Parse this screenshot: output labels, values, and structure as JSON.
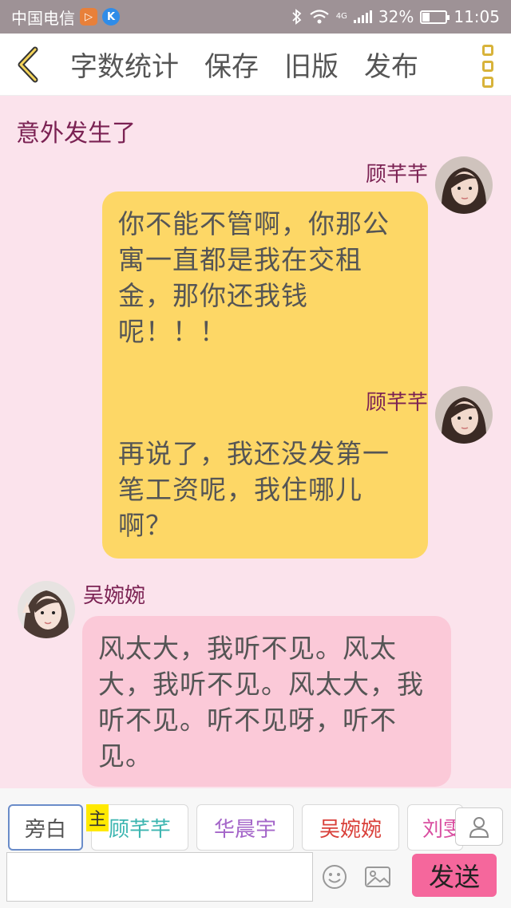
{
  "status_bar": {
    "carrier": "中国电信",
    "battery": "32%",
    "battery_level": 0.32,
    "time": "11:05",
    "network": "4G"
  },
  "toolbar": {
    "word_count": "字数统计",
    "save": "保存",
    "old_version": "旧版",
    "publish": "发布"
  },
  "chapter_title": "意外发生了",
  "messages": [
    {
      "speaker": "顾芊芊",
      "side": "right",
      "text": "你不能不管啊，你那公寓一直都是我在交租金，那你还我钱呢！！！"
    },
    {
      "speaker": "顾芊芊",
      "side": "right",
      "text": "再说了，我还没发第一笔工资呢，我住哪儿啊？"
    },
    {
      "speaker": "吴婉婉",
      "side": "left",
      "text": "风太大，我听不见。风太大，我听不见。风太大，我听不见。听不见呀，听不见。"
    }
  ],
  "roles": [
    {
      "label": "旁白",
      "color": "#555555"
    },
    {
      "label": "顾芊芊",
      "color": "#3bb5b0"
    },
    {
      "label": "华晨宇",
      "color": "#a466c9"
    },
    {
      "label": "吴婉婉",
      "color": "#d9403a"
    },
    {
      "label": "刘雯",
      "color": "#d94ea0"
    }
  ],
  "main_tag": "主",
  "input": {
    "value": "",
    "placeholder": ""
  },
  "send_label": "发送",
  "colors": {
    "accent_yellow": "#fdd766",
    "bubble_pink": "#fbc9d8",
    "send_pink": "#f5679c",
    "name_color": "#7b2253"
  }
}
